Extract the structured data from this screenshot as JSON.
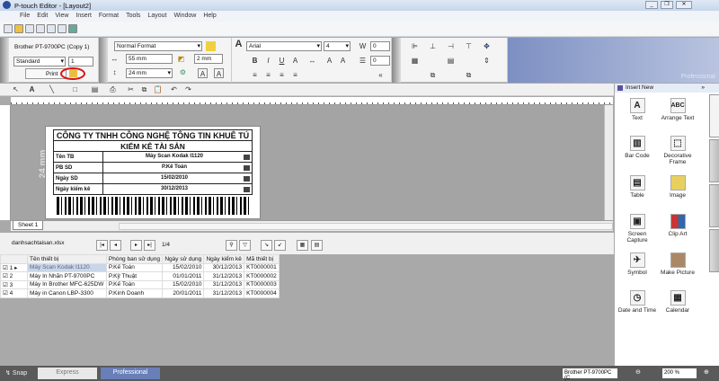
{
  "window": {
    "title": "P-touch Editor - [Layout2]"
  },
  "menu": [
    "File",
    "Edit",
    "View",
    "Insert",
    "Format",
    "Tools",
    "Layout",
    "Window",
    "Help"
  ],
  "ribbon": {
    "printer": "Brother PT-9700PC (Copy 1)",
    "quality": "Standard",
    "copies": "1",
    "print_label": "Print",
    "format": "Normal Format",
    "width": "55 mm",
    "length": "24 mm",
    "margin": "2 mm",
    "font": "Arial",
    "font_size": "4",
    "char_spacing": "0",
    "line_spacing": "0",
    "brand": "Professional"
  },
  "canvas": {
    "ruler_label": "24 mm",
    "sheet_tab": "Sheet 1",
    "label": {
      "title": "CÔNG TY TNHH CÔNG NGHỆ TÔNG TIN KHUÊ TÚ",
      "subtitle": "KIỂM KÊ TÀI SẢN",
      "rows": [
        [
          "Tên TB",
          "Máy Scan Kodak I1120"
        ],
        [
          "PB SD",
          "P.Kế Toán"
        ],
        [
          "Ngày SD",
          "15/02/2010"
        ],
        [
          "Ngày kiểm kê",
          "30/12/2013"
        ]
      ]
    }
  },
  "database": {
    "file": "danhsachtaisan.xlsx",
    "record": "1/4",
    "columns": [
      "Tên thiết bị",
      "Phòng ban sử dụng",
      "Ngày sử dụng",
      "Ngày kiểm kê",
      "Mã thiết bị"
    ],
    "rows": [
      [
        "1",
        "Máy Scan Kodak I1120",
        "P.Kế Toán",
        "15/02/2010",
        "30/12/2013",
        "KT0000001"
      ],
      [
        "2",
        "Máy In Nhãn PT-9700PC",
        "P.Kỹ Thuật",
        "01/01/2011",
        "31/12/2013",
        "KT0000002"
      ],
      [
        "3",
        "Máy In Brother MFC-625DW",
        "P.Kế Toán",
        "15/02/2010",
        "31/12/2013",
        "KT0000003"
      ],
      [
        "4",
        "Máy in Canon LBP-3300",
        "P.Kinh Doanh",
        "20/01/2011",
        "31/12/2013",
        "KT0000004"
      ]
    ]
  },
  "panel": {
    "title": "Insert New",
    "items": [
      "Text",
      "Arrange Text",
      "Bar Code",
      "Decorative Frame",
      "Table",
      "Image",
      "Screen Capture",
      "Clip Art",
      "Symbol",
      "Make Picture",
      "Date and Time",
      "Calendar"
    ]
  },
  "status": {
    "snap": "Snap",
    "express": "Express",
    "professional": "Professional",
    "printer": "Brother PT-9700PC (C",
    "zoom": "200 %"
  }
}
